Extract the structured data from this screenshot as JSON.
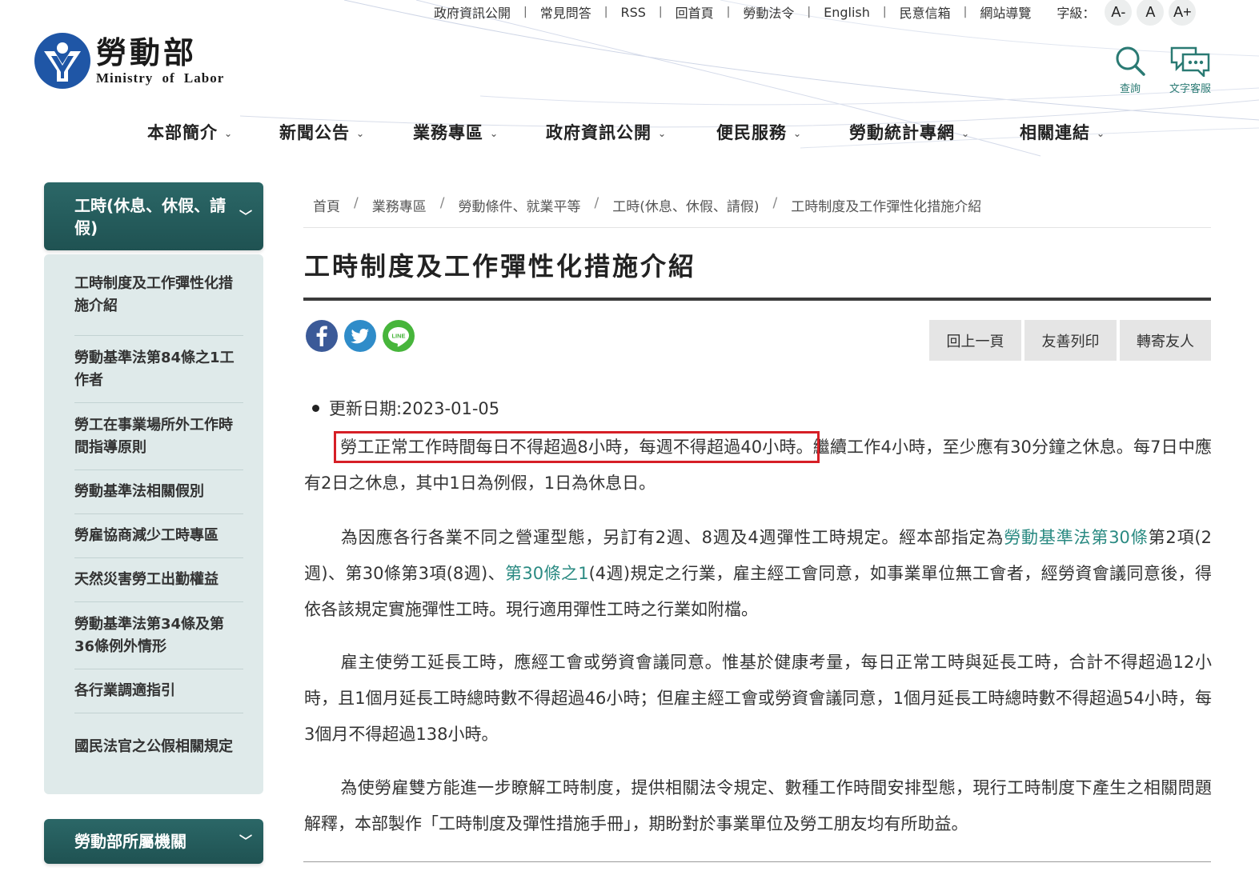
{
  "utility": {
    "links": [
      "政府資訊公開",
      "常見問答",
      "RSS",
      "回首頁",
      "勞動法令",
      "English",
      "民意信箱",
      "網站導覽"
    ],
    "font_size_label": "字級：",
    "font_sizes": [
      "A-",
      "A",
      "A+"
    ]
  },
  "logo": {
    "name_cn": "勞動部",
    "name_en": "Ministry of Labor"
  },
  "tools": {
    "search_label": "查詢",
    "chat_label": "文字客服"
  },
  "nav": [
    "本部簡介",
    "新聞公告",
    "業務專區",
    "政府資訊公開",
    "便民服務",
    "勞動統計專網",
    "相關連結"
  ],
  "sidebar": {
    "section_title": "工時(休息、休假、請假)",
    "items": [
      "工時制度及工作彈性化措施介紹",
      "勞動基準法第84條之1工作者",
      "勞工在事業場所外工作時間指導原則",
      "勞動基準法相關假別",
      "勞雇協商減少工時專區",
      "天然災害勞工出勤權益",
      "勞動基準法第34條及第36條例外情形",
      "各行業調適指引",
      "國民法官之公假相關規定"
    ],
    "section2_title": "勞動部所屬機關"
  },
  "breadcrumb": [
    "首頁",
    "業務專區",
    "勞動條件、就業平等",
    "工時(休息、休假、請假)",
    "工時制度及工作彈性化措施介紹"
  ],
  "page_title": "工時制度及工作彈性化措施介紹",
  "actions": {
    "back": "回上一頁",
    "print": "友善列印",
    "send": "轉寄友人"
  },
  "share": {
    "line_label": "LINE"
  },
  "content": {
    "update_date": "更新日期:2023-01-05",
    "p1_highlight": "勞工正常工作時間每日不得超過8小時，每週不得超過40小時。",
    "p1_rest": "繼續工作4小時，至少應有30分鐘之休息。每7日中應有2日之休息，其中1日為例假，1日為休息日。",
    "p2_a": "為因應各行各業不同之營運型態，另訂有2週、8週及4週彈性工時規定。經本部指定為",
    "p2_link1": "勞動基準法第30條",
    "p2_b": "第2項(2週)、第30條第3項(8週)、",
    "p2_link2": "第30條之1",
    "p2_c": "(4週)規定之行業，雇主經工會同意，如事業單位無工會者，經勞資會議同意後，得依各該規定實施彈性工時。現行適用彈性工時之行業如附檔。",
    "p3": "雇主使勞工延長工時，應經工會或勞資會議同意。惟基於健康考量，每日正常工時與延長工時，合計不得超過12小時，且1個月延長工時總時數不得超過46小時；但雇主經工會或勞資會議同意，1個月延長工時總時數不得超過54小時，每3個月不得超過138小時。",
    "p4": "為使勞雇雙方能進一步瞭解工時制度，提供相關法令規定、數種工作時間安排型態，現行工時制度下產生之相關問題解釋，本部製作「工時制度及彈性措施手冊」，期盼對於事業單位及勞工朋友均有所助益。"
  },
  "colors": {
    "accent": "#245b5b",
    "link": "#2a8a82",
    "highlight_box": "#d61f26",
    "sidebar_bg": "#dfeaea",
    "logo_blue": "#1f56a6"
  }
}
